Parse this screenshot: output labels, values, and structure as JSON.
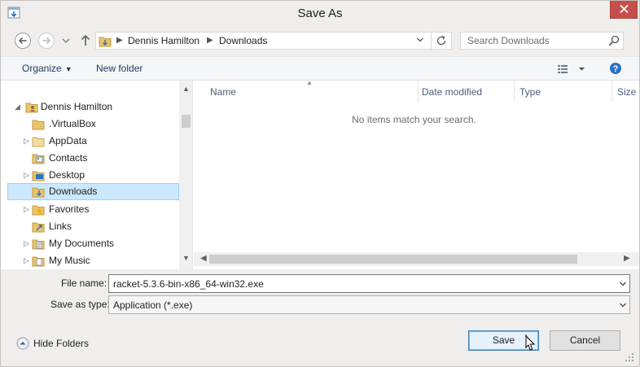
{
  "window": {
    "title": "Save As",
    "accent_close": "#c74f4a"
  },
  "address": {
    "crumbs": [
      "Dennis Hamilton",
      "Downloads"
    ]
  },
  "search": {
    "placeholder": "Search Downloads"
  },
  "toolbar": {
    "organize_label": "Organize",
    "new_folder_label": "New folder"
  },
  "tree": {
    "items": [
      {
        "label": "Dennis Hamilton",
        "icon": "user-folder-icon",
        "expanded": true
      },
      {
        "label": ".VirtualBox",
        "icon": "folder-icon"
      },
      {
        "label": "AppData",
        "icon": "folder-icon",
        "has_children": true
      },
      {
        "label": "Contacts",
        "icon": "contacts-folder-icon"
      },
      {
        "label": "Desktop",
        "icon": "desktop-folder-icon",
        "has_children": true
      },
      {
        "label": "Downloads",
        "icon": "downloads-folder-icon",
        "selected": true
      },
      {
        "label": "Favorites",
        "icon": "favorites-folder-icon",
        "has_children": true
      },
      {
        "label": "Links",
        "icon": "links-folder-icon"
      },
      {
        "label": "My Documents",
        "icon": "documents-folder-icon",
        "has_children": true
      },
      {
        "label": "My Music",
        "icon": "music-folder-icon",
        "has_children": true
      }
    ]
  },
  "files": {
    "columns": [
      "Name",
      "Date modified",
      "Type",
      "Size"
    ],
    "empty_message": "No items match your search."
  },
  "form": {
    "file_name_label": "File name:",
    "file_name_value": "racket-5.3.6-bin-x86_64-win32.exe",
    "save_type_label": "Save as type:",
    "save_type_value": "Application (*.exe)"
  },
  "footer": {
    "hide_folders_label": "Hide Folders",
    "save_label": "Save",
    "cancel_label": "Cancel"
  }
}
